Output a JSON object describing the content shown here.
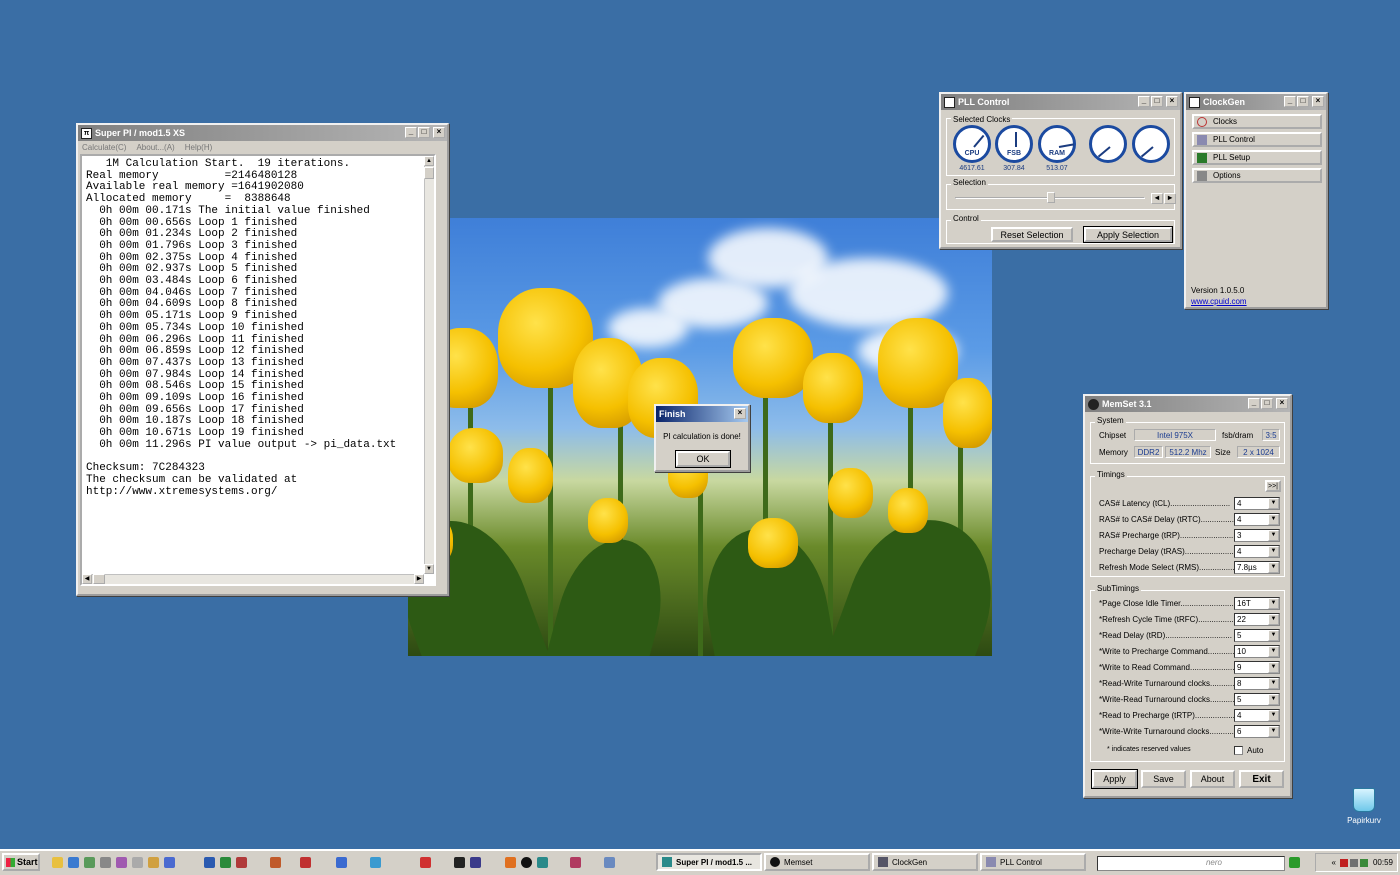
{
  "desktop": {
    "recycle_bin_label": "Papirkurv"
  },
  "superpi": {
    "title": "Super PI / mod1.5 XS",
    "menu": [
      "Calculate(C)",
      "About...(A)",
      "Help(H)"
    ],
    "output": "   1M Calculation Start.  19 iterations.\nReal memory          =2146480128\nAvailable real memory =1641902080\nAllocated memory     =  8388648\n  0h 00m 00.171s The initial value finished\n  0h 00m 00.656s Loop 1 finished\n  0h 00m 01.234s Loop 2 finished\n  0h 00m 01.796s Loop 3 finished\n  0h 00m 02.375s Loop 4 finished\n  0h 00m 02.937s Loop 5 finished\n  0h 00m 03.484s Loop 6 finished\n  0h 00m 04.046s Loop 7 finished\n  0h 00m 04.609s Loop 8 finished\n  0h 00m 05.171s Loop 9 finished\n  0h 00m 05.734s Loop 10 finished\n  0h 00m 06.296s Loop 11 finished\n  0h 00m 06.859s Loop 12 finished\n  0h 00m 07.437s Loop 13 finished\n  0h 00m 07.984s Loop 14 finished\n  0h 00m 08.546s Loop 15 finished\n  0h 00m 09.109s Loop 16 finished\n  0h 00m 09.656s Loop 17 finished\n  0h 00m 10.187s Loop 18 finished\n  0h 00m 10.671s Loop 19 finished\n  0h 00m 11.296s PI value output -> pi_data.txt\n\nChecksum: 7C284323\nThe checksum can be validated at\nhttp://www.xtremesystems.org/"
  },
  "finish_dialog": {
    "title": "Finish",
    "message": "PI calculation is done!",
    "ok_label": "OK"
  },
  "pll_control": {
    "title": "PLL Control",
    "selected_clocks_label": "Selected Clocks",
    "gauges": [
      {
        "name": "CPU",
        "value": "4617.61"
      },
      {
        "name": "FSB",
        "value": "307.84"
      },
      {
        "name": "RAM",
        "value": "513.07"
      },
      {
        "name": "",
        "value": ""
      },
      {
        "name": "",
        "value": ""
      }
    ],
    "selection_label": "Selection",
    "control_label": "Control",
    "reset_label": "Reset Selection",
    "apply_label": "Apply Selection"
  },
  "clockgen": {
    "title": "ClockGen",
    "buttons": [
      "Clocks",
      "PLL Control",
      "PLL Setup",
      "Options"
    ],
    "version": "Version 1.0.5.0",
    "link": "www.cpuid.com"
  },
  "memset": {
    "title": "MemSet 3.1",
    "system_label": "System",
    "chipset_label": "Chipset",
    "chipset_value": "Intel 975X",
    "fsb_dram_label": "fsb/dram",
    "fsb_dram_value": "3:5",
    "memory_label": "Memory",
    "memory_type": "DDR2",
    "memory_speed": "512.2 Mhz",
    "size_label": "Size",
    "size_value": "2 x 1024",
    "timings_label": "Timings",
    "expand_label": ">>|",
    "timings": [
      {
        "label": "CAS# Latency (tCL)...........................",
        "value": "4"
      },
      {
        "label": "RAS# to CAS# Delay (tRTC).................",
        "value": "4"
      },
      {
        "label": "RAS# Precharge (tRP)........................",
        "value": "3"
      },
      {
        "label": "Precharge Delay  (tRAS)......................",
        "value": "4"
      },
      {
        "label": "Refresh Mode Select (RMS)..................",
        "value": "7.8µs"
      }
    ],
    "subtimings_label": "SubTimings",
    "subtimings": [
      {
        "label": "*Page Close Idle Timer........................",
        "value": "16T"
      },
      {
        "label": "*Refresh Cycle Time (tRFC)...................",
        "value": "22"
      },
      {
        "label": "*Read Delay (tRD)..............................",
        "value": "5"
      },
      {
        "label": "*Write to Precharge Command...............",
        "value": "10"
      },
      {
        "label": "*Write to Read Command.......................",
        "value": "9"
      },
      {
        "label": "*Read-Write Turnaround clocks...............",
        "value": "8"
      },
      {
        "label": "*Write-Read Turnaround clocks...............",
        "value": "5"
      },
      {
        "label": "*Read to Precharge (tRTP)....................",
        "value": "4"
      },
      {
        "label": "*Write-Write Turnaround clocks...............",
        "value": "6"
      }
    ],
    "reserved_note": "* indicates reserved values",
    "auto_label": "Auto",
    "buttons": [
      "Apply",
      "Save",
      "About",
      "Exit"
    ]
  },
  "taskbar": {
    "start_label": "Start",
    "tasks": [
      "Super PI / mod1.5 ...",
      "Memset",
      "ClockGen",
      "PLL Control"
    ],
    "search_brand": "nero",
    "clock": "00:59",
    "tray_chevron": "«"
  }
}
